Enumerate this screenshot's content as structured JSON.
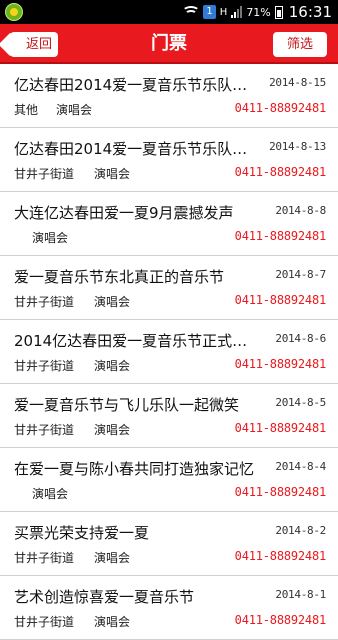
{
  "status_bar": {
    "badge": "1",
    "signal_label": "H",
    "battery_pct": "71%",
    "time": "16:31"
  },
  "header": {
    "back_label": "返回",
    "title": "门票",
    "filter_label": "筛选"
  },
  "items": [
    {
      "title": "亿达春田2014爱一夏音乐节乐队…",
      "date": "2014-8-15",
      "location": "其他",
      "type": "演唱会",
      "phone": "0411-88892481"
    },
    {
      "title": "亿达春田2014爱一夏音乐节乐队…",
      "date": "2014-8-13",
      "location": "甘井子街道",
      "type": "演唱会",
      "phone": "0411-88892481"
    },
    {
      "title": "大连亿达春田爱一夏9月震撼发声",
      "date": "2014-8-8",
      "location": "",
      "type": "演唱会",
      "phone": "0411-88892481"
    },
    {
      "title": "爱一夏音乐节东北真正的音乐节",
      "date": "2014-8-7",
      "location": "甘井子街道",
      "type": "演唱会",
      "phone": "0411-88892481"
    },
    {
      "title": "2014亿达春田爱一夏音乐节正式…",
      "date": "2014-8-6",
      "location": "甘井子街道",
      "type": "演唱会",
      "phone": "0411-88892481"
    },
    {
      "title": "爱一夏音乐节与飞儿乐队一起微笑",
      "date": "2014-8-5",
      "location": "甘井子街道",
      "type": "演唱会",
      "phone": "0411-88892481"
    },
    {
      "title": "在爱一夏与陈小春共同打造独家记忆",
      "date": "2014-8-4",
      "location": "",
      "type": "演唱会",
      "phone": "0411-88892481"
    },
    {
      "title": "买票光荣支持爱一夏",
      "date": "2014-8-2",
      "location": "甘井子街道",
      "type": "演唱会",
      "phone": "0411-88892481"
    },
    {
      "title": "艺术创造惊喜爱一夏音乐节",
      "date": "2014-8-1",
      "location": "甘井子街道",
      "type": "演唱会",
      "phone": "0411-88892481"
    }
  ]
}
